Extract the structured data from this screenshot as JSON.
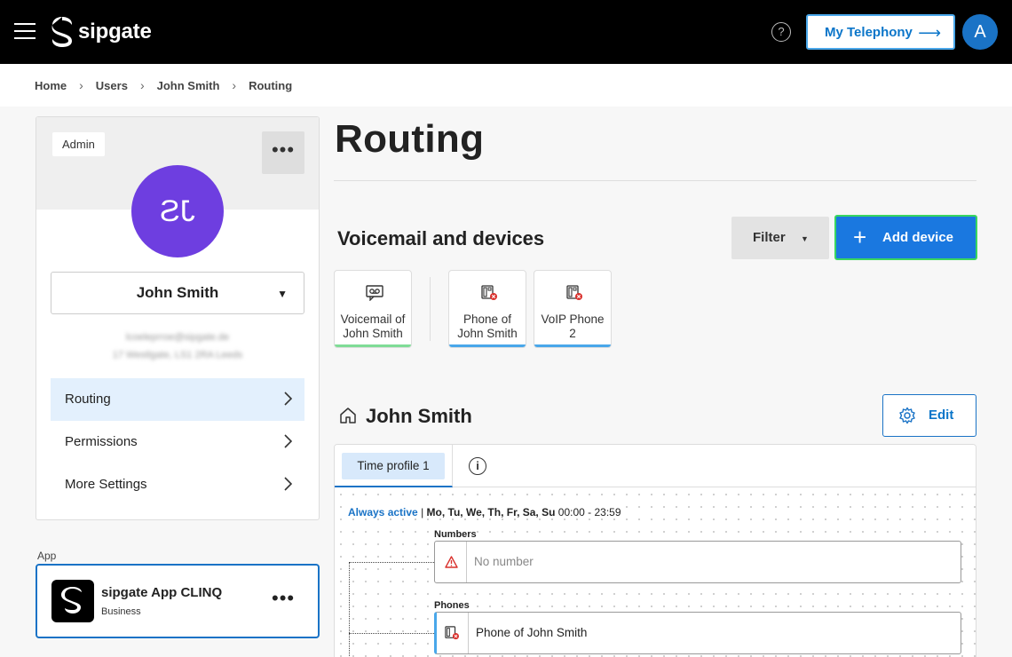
{
  "topbar": {
    "brand": "sipgate",
    "help_icon": "question-circle-icon",
    "telephony_label": "My Telephony",
    "avatar_initial": "A"
  },
  "breadcrumb": {
    "items": [
      "Home",
      "Users",
      "John Smith",
      "Routing"
    ]
  },
  "user_card": {
    "role_badge": "Admin",
    "avatar_initials": "JS",
    "avatar_color": "#6e3ee0",
    "selected_user": "John Smith",
    "email_blurred": "lcoeleprroe@sipgate.de",
    "address_blurred": "17 Westlgate, LS1 2RA Leeds",
    "nav": [
      {
        "label": "Routing",
        "active": true
      },
      {
        "label": "Permissions",
        "active": false
      },
      {
        "label": "More Settings",
        "active": false
      }
    ]
  },
  "app_section": {
    "label": "App",
    "name": "sipgate App CLINQ",
    "plan": "Business"
  },
  "main": {
    "title": "Routing",
    "section_title": "Voicemail and devices",
    "filter_label": "Filter",
    "add_device_label": "Add device",
    "devices": [
      {
        "line1": "Voicemail of",
        "line2": "John Smith",
        "icon": "voicemail-icon",
        "bar_color": "#7fdc96"
      },
      {
        "line1": "Phone of",
        "line2": "John Smith",
        "icon": "phone-error-icon",
        "bar_color": "#49a7ea"
      },
      {
        "line1": "VoIP Phone",
        "line2": "2",
        "icon": "phone-error-icon",
        "bar_color": "#49a7ea"
      }
    ],
    "profile_name": "John Smith",
    "edit_label": "Edit"
  },
  "routing": {
    "tab_label": "Time profile 1",
    "always_active": "Always active",
    "separator": "|",
    "days": "Mo, Tu, We, Th, Fr, Sa, Su",
    "time": "00:00 - 23:59",
    "numbers_label": "Numbers",
    "numbers_value": "No number",
    "phones_label": "Phones",
    "phones_value": "Phone of John Smith"
  },
  "colors": {
    "accent": "#1a73c6",
    "primary_button": "#1a78e0",
    "focus_ring": "#39d65f",
    "warning": "#d9302c"
  }
}
